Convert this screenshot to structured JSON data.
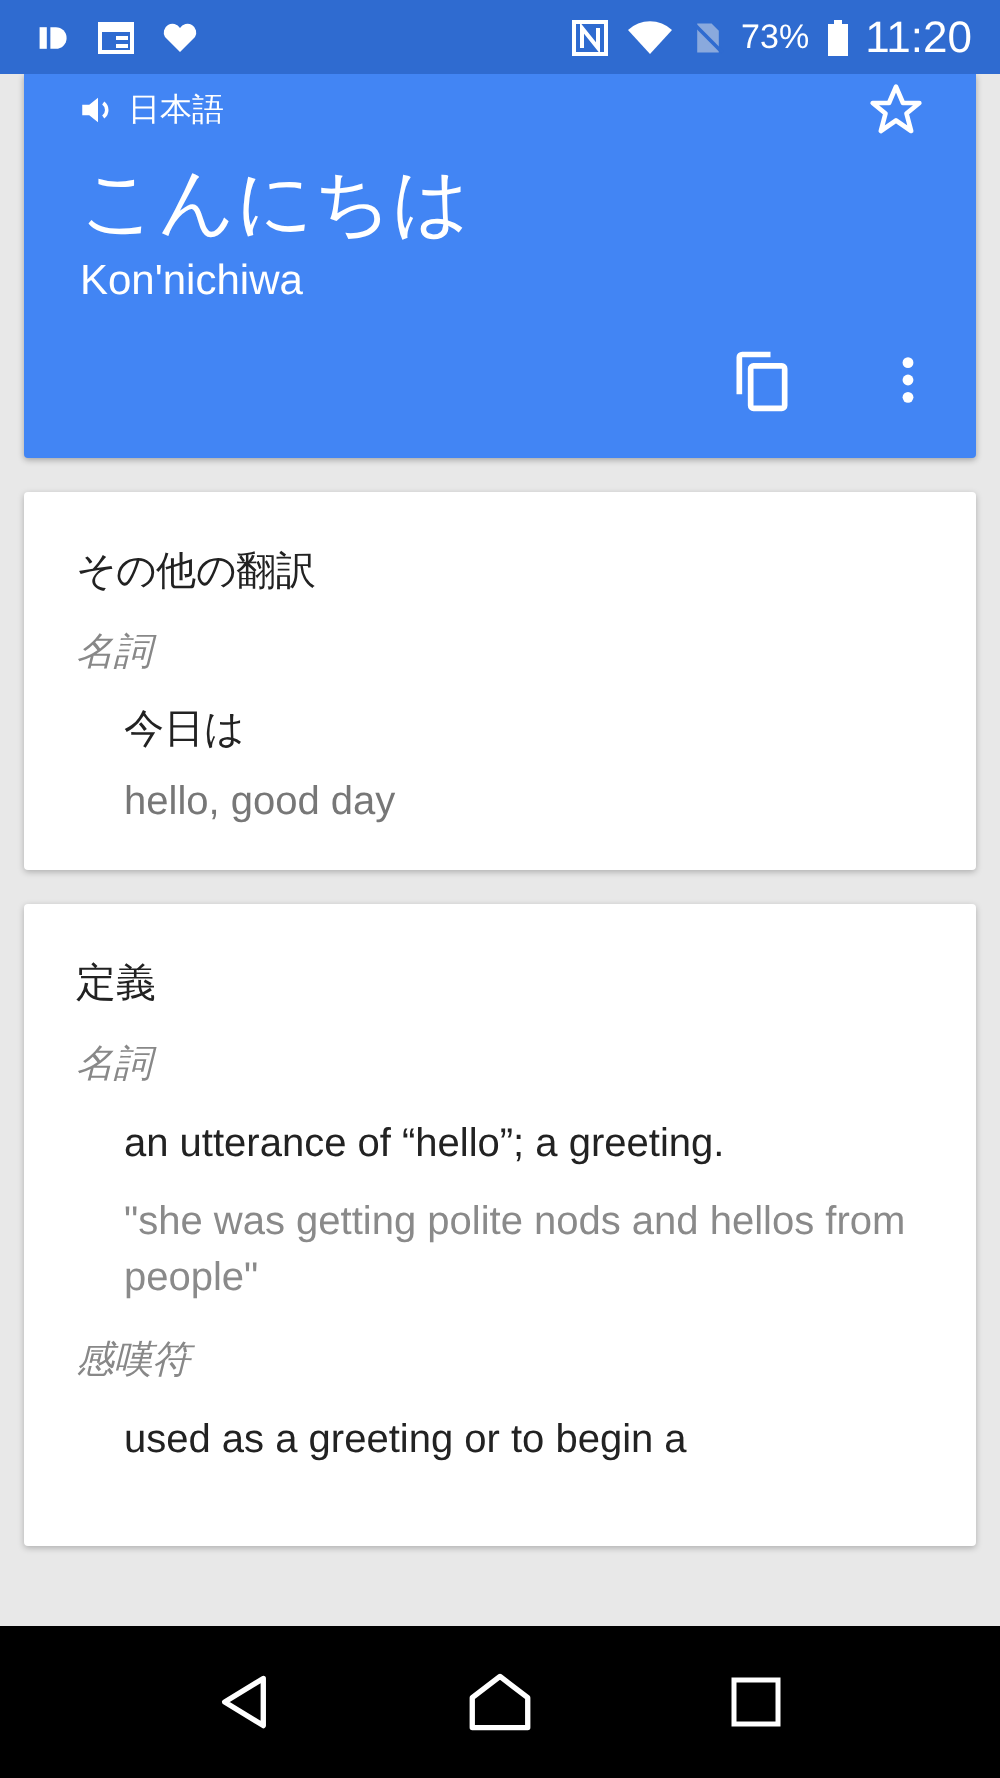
{
  "status_bar": {
    "battery": "73%",
    "time": "11:20"
  },
  "result_card": {
    "language": "日本語",
    "starred": false,
    "text": "こんにちは",
    "romanization": "Kon'nichiwa"
  },
  "other_translations": {
    "title": "その他の翻訳",
    "groups": [
      {
        "pos": "名詞",
        "items": [
          {
            "word": "今日は",
            "meanings": "hello, good day"
          }
        ]
      }
    ]
  },
  "definitions": {
    "title": "定義",
    "groups": [
      {
        "pos": "名詞",
        "items": [
          {
            "definition": "an utterance of “hello”; a greeting.",
            "example": "\"she was getting polite nods and hellos from people\""
          }
        ]
      },
      {
        "pos": "感嘆符",
        "items": [
          {
            "definition": "used as a greeting or to begin a"
          }
        ]
      }
    ]
  }
}
